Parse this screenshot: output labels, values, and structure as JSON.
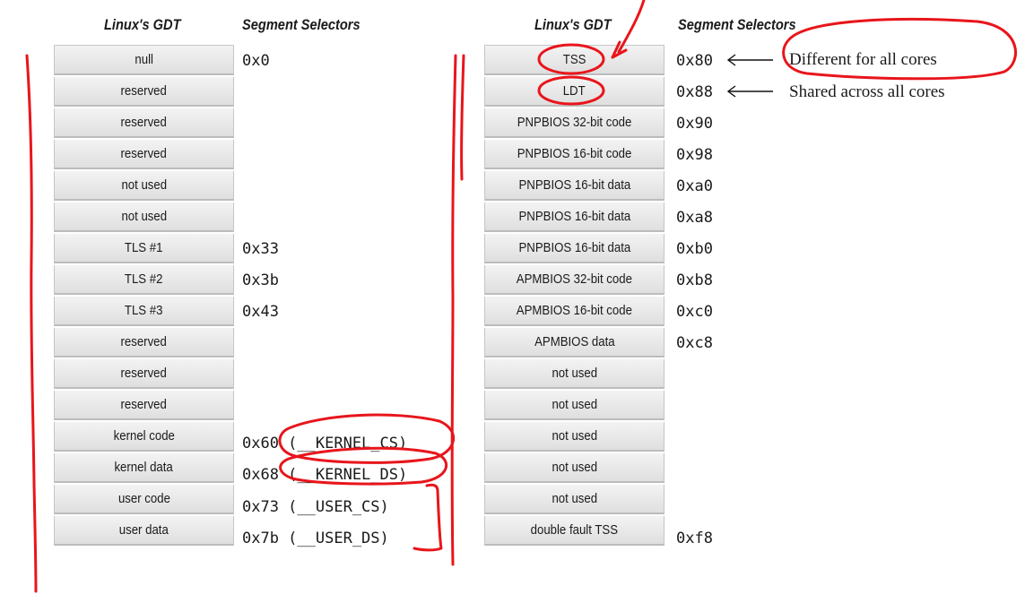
{
  "left": {
    "header_gdt": "Linux's GDT",
    "header_selectors": "Segment Selectors",
    "entries": [
      "null",
      "reserved",
      "reserved",
      "reserved",
      "not used",
      "not used",
      "TLS #1",
      "TLS #2",
      "TLS #3",
      "reserved",
      "reserved",
      "reserved",
      "kernel code",
      "kernel data",
      "user code",
      "user data"
    ],
    "selectors": [
      "0x0",
      "",
      "",
      "",
      "",
      "",
      "0x33",
      "0x3b",
      "0x43",
      "",
      "",
      "",
      "0x60 (__KERNEL_CS)",
      "0x68 (__KERNEL_DS)",
      "0x73 (__USER_CS)",
      "0x7b (__USER_DS)"
    ]
  },
  "right": {
    "header_gdt": "Linux's GDT",
    "header_selectors": "Segment Selectors",
    "entries": [
      "TSS",
      "LDT",
      "PNPBIOS 32-bit code",
      "PNPBIOS 16-bit code",
      "PNPBIOS 16-bit data",
      "PNPBIOS 16-bit data",
      "PNPBIOS 16-bit data",
      "APMBIOS 32-bit code",
      "APMBIOS 16-bit code",
      "APMBIOS data",
      "not used",
      "not used",
      "not used",
      "not used",
      "not used",
      "double fault TSS"
    ],
    "selectors": [
      "0x80",
      "0x88",
      "0x90",
      "0x98",
      "0xa0",
      "0xa8",
      "0xb0",
      "0xb8",
      "0xc0",
      "0xc8",
      "",
      "",
      "",
      "",
      "",
      "0xf8"
    ]
  },
  "annotations": {
    "tss_note": "Different for all cores",
    "ldt_note": "Shared across all cores",
    "ink_color": "#e8151b"
  }
}
